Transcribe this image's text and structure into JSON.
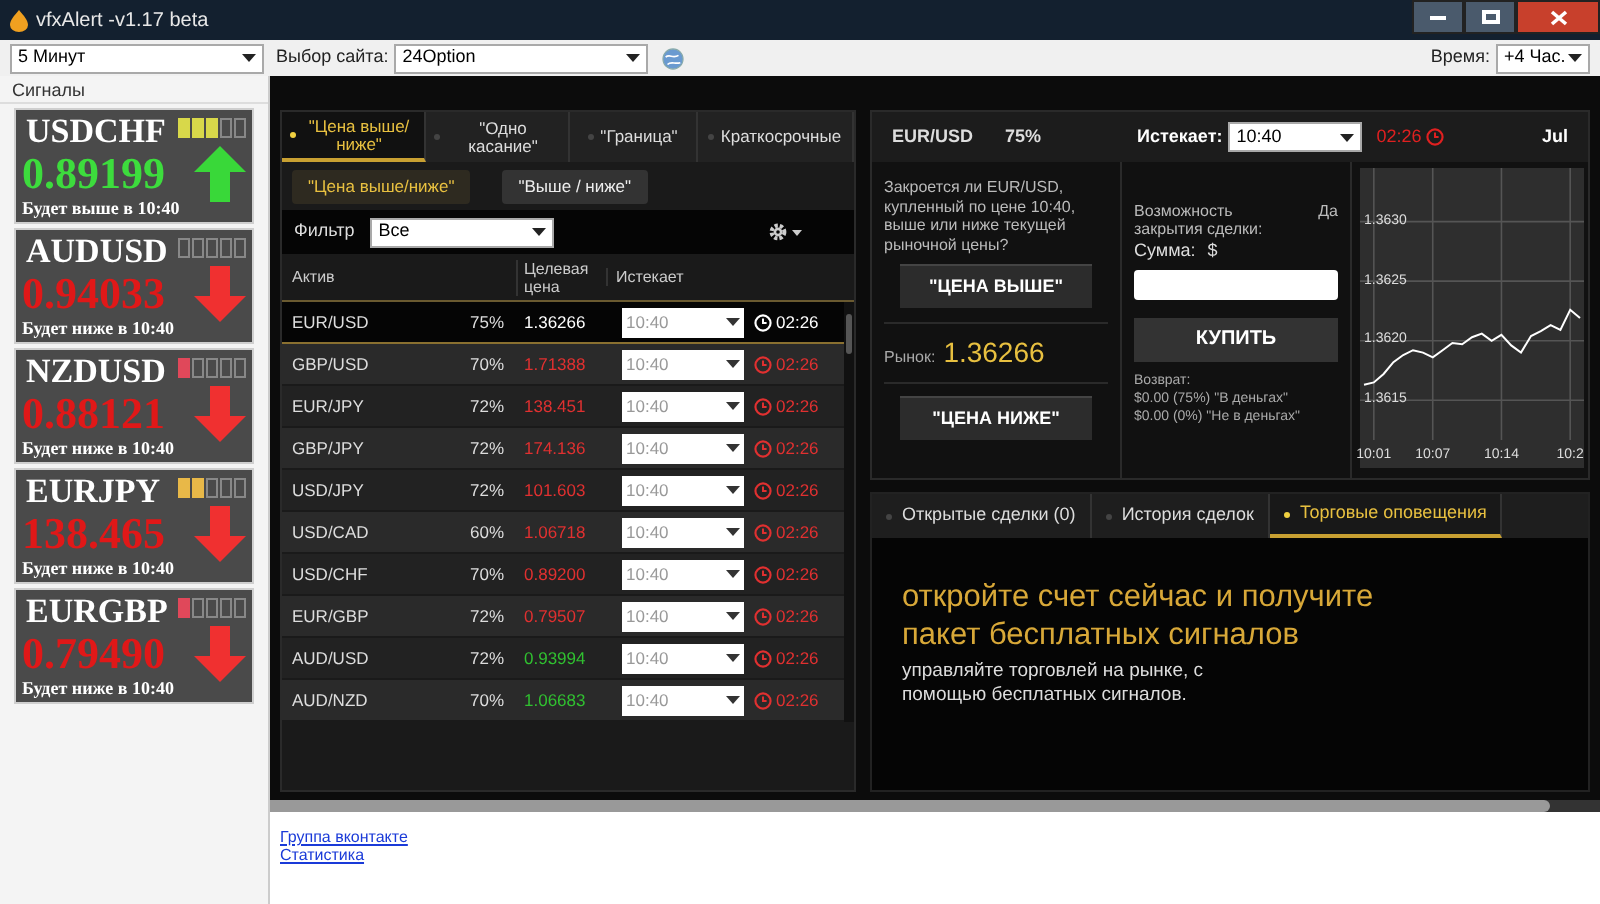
{
  "window": {
    "title": "vfxAlert -v1.17 beta"
  },
  "toolbar": {
    "period": "5 Минут",
    "site_label": "Выбор сайта:",
    "site": "24Option",
    "time_label": "Время:",
    "timezone": "+4 Час."
  },
  "signals": {
    "title": "Сигналы",
    "items": [
      {
        "pair": "USDCHF",
        "price": "0.89199",
        "note": "Будет выше в 10:40",
        "kind": "up",
        "level": 0.6,
        "color": "#d8d84a"
      },
      {
        "pair": "AUDUSD",
        "price": "0.94033",
        "note": "Будет ниже в 10:40",
        "kind": "down",
        "level": 0
      },
      {
        "pair": "NZDUSD",
        "price": "0.88121",
        "note": "Будет ниже в 10:40",
        "kind": "down",
        "level": 0.2,
        "color": "#e0485a"
      },
      {
        "pair": "EURJPY",
        "price": "138.465",
        "note": "Будет ниже в 10:40",
        "kind": "down",
        "level": 0.4,
        "color": "#e8b848"
      },
      {
        "pair": "EURGBP",
        "price": "0.79490",
        "note": "Будет ниже в 10:40",
        "kind": "down",
        "level": 0.2,
        "color": "#e0485a"
      }
    ]
  },
  "option_tabs": [
    {
      "label": "\"Цена выше/ ниже\"",
      "selected": true
    },
    {
      "label": "\"Одно касание\"",
      "selected": false
    },
    {
      "label": "\"Граница\"",
      "selected": false
    },
    {
      "label": "Краткосрочные",
      "selected": false
    }
  ],
  "sub_tabs": [
    {
      "label": "\"Цена выше/ниже\"",
      "selected": true
    },
    {
      "label": "\"Выше / ниже\"",
      "selected": false
    }
  ],
  "filter": {
    "label": "Фильтр",
    "value": "Все"
  },
  "table": {
    "columns": [
      "Актив",
      "Целевая цена",
      "Истекает"
    ],
    "rows": [
      {
        "asset": "EUR/USD",
        "payout": "75%",
        "price": "1.36266",
        "color": "#ffffff",
        "expiry": "10:40",
        "timer": "02:26",
        "selected": true
      },
      {
        "asset": "GBP/USD",
        "payout": "70%",
        "price": "1.71388",
        "color": "#e03030",
        "expiry": "10:40",
        "timer": "02:26",
        "selected": false
      },
      {
        "asset": "EUR/JPY",
        "payout": "72%",
        "price": "138.451",
        "color": "#e03030",
        "expiry": "10:40",
        "timer": "02:26",
        "selected": false
      },
      {
        "asset": "GBP/JPY",
        "payout": "72%",
        "price": "174.136",
        "color": "#e03030",
        "expiry": "10:40",
        "timer": "02:26",
        "selected": false
      },
      {
        "asset": "USD/JPY",
        "payout": "72%",
        "price": "101.603",
        "color": "#e03030",
        "expiry": "10:40",
        "timer": "02:26",
        "selected": false
      },
      {
        "asset": "USD/CAD",
        "payout": "60%",
        "price": "1.06718",
        "color": "#e03030",
        "expiry": "10:40",
        "timer": "02:26",
        "selected": false
      },
      {
        "asset": "USD/CHF",
        "payout": "70%",
        "price": "0.89200",
        "color": "#e03030",
        "expiry": "10:40",
        "timer": "02:26",
        "selected": false
      },
      {
        "asset": "EUR/GBP",
        "payout": "72%",
        "price": "0.79507",
        "color": "#e03030",
        "expiry": "10:40",
        "timer": "02:26",
        "selected": false
      },
      {
        "asset": "AUD/USD",
        "payout": "72%",
        "price": "0.93994",
        "color": "#30c030",
        "expiry": "10:40",
        "timer": "02:26",
        "selected": false
      },
      {
        "asset": "AUD/NZD",
        "payout": "70%",
        "price": "1.06683",
        "color": "#30c030",
        "expiry": "10:40",
        "timer": "02:26",
        "selected": false
      }
    ]
  },
  "trade": {
    "asset": "EUR/USD",
    "payout": "75%",
    "expiry_label": "Истекает:",
    "expiry": "10:40",
    "timer": "02:26",
    "date": "Jul",
    "question": "Закроется ли EUR/USD, купленный по цене 10:40, выше или ниже текущей рыночной цены?",
    "call_button": "\"ЦЕНА ВЫШЕ\"",
    "market_label": "Рынок:",
    "market_price": "1.36266",
    "put_button": "\"ЦЕНА НИЖЕ\"",
    "close_label": "Возможность закрытия сделки:",
    "close_value": "Да",
    "amount_label": "Сумма:",
    "currency": "$",
    "buy_button": "КУПИТЬ",
    "return_label": "Возврат:",
    "return_in": "$0.00 (75%) \"В деньгах\"",
    "return_out": "$0.00 (0%) \"Не в деньгах\"",
    "chart_data": {
      "type": "line",
      "categories": [
        null,
        "10:01",
        null,
        null,
        null,
        null,
        null,
        "10:07",
        null,
        null,
        null,
        null,
        null,
        null,
        "10:14",
        null,
        null,
        null,
        null,
        null,
        null,
        "10:2",
        null
      ],
      "series": [
        {
          "color": "#ffffff",
          "values": [
            1.36163,
            1.36165,
            1.36172,
            1.36182,
            1.36188,
            1.36192,
            1.3619,
            1.36186,
            1.36192,
            1.36198,
            1.36197,
            1.36203,
            1.36206,
            1.362,
            1.36205,
            1.36196,
            1.3619,
            1.36204,
            1.36208,
            1.36213,
            1.36209,
            1.36226,
            1.36219
          ]
        }
      ],
      "ylim": [
        1.3612,
        1.36345
      ],
      "grid": true,
      "yticks": [
        {
          "value": 1.363,
          "label": "1.3630"
        },
        {
          "value": 1.3625,
          "label": "1.3625"
        },
        {
          "value": 1.362,
          "label": "1.3620"
        },
        {
          "value": 1.3615,
          "label": "1.3615"
        }
      ]
    }
  },
  "bottom_tabs": [
    {
      "label": "Открытые сделки (0)",
      "selected": false
    },
    {
      "label": "История сделок",
      "selected": false
    },
    {
      "label": "Торговые оповещения",
      "selected": true
    }
  ],
  "promo": {
    "headline": "откройте счет сейчас и получите пакет бесплатных сигналов",
    "text": "управляйте торговлей на рынке, с помощью бесплатных сигналов."
  },
  "links": [
    "Группа вконтакте",
    "Статистика"
  ]
}
